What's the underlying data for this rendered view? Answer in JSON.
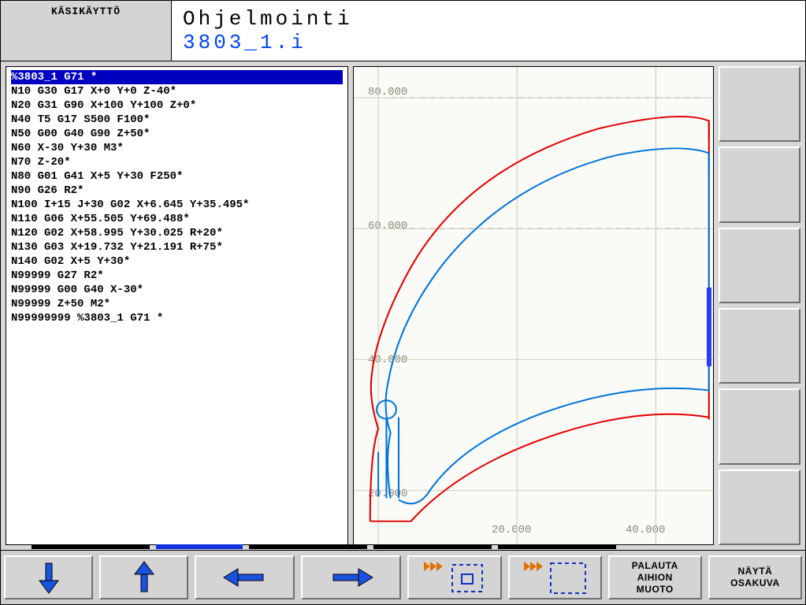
{
  "header": {
    "mode_label": "KÄSIKÄYTTÖ",
    "title": "Ohjelmointi",
    "file": "3803_1.i"
  },
  "code": {
    "selected_index": 0,
    "lines": [
      "%3803_1 G71 *",
      "N10 G30 G17 X+0 Y+0 Z-40*",
      "N20 G31 G90 X+100 Y+100 Z+0*",
      "N40 T5 G17 S500 F100*",
      "N50 G00 G40 G90 Z+50*",
      "N60 X-30 Y+30 M3*",
      "N70 Z-20*",
      "N80 G01 G41 X+5 Y+30 F250*",
      "N90 G26 R2*",
      "N100 I+15 J+30 G02 X+6.645 Y+35.495*",
      "N110 G06 X+55.505 Y+69.488*",
      "N120 G02 X+58.995 Y+30.025 R+20*",
      "N130 G03 X+19.732 Y+21.191 R+75*",
      "N140 G02 X+5 Y+30*",
      "N99999 G27 R2*",
      "N99999 G00 G40 X-30*",
      "N99999 Z+50 M2*",
      "N99999999 %3803_1 G71 *"
    ]
  },
  "graph": {
    "y_labels": [
      "80.000",
      "60.000",
      "40.000",
      "20.000"
    ],
    "x_labels": [
      "20.000",
      "40.000"
    ]
  },
  "bottom": {
    "reset_label": "PALAUTA\nAIHION\nMUOTO",
    "show_label": "NÄYTÄ\nOSAKUVA"
  }
}
